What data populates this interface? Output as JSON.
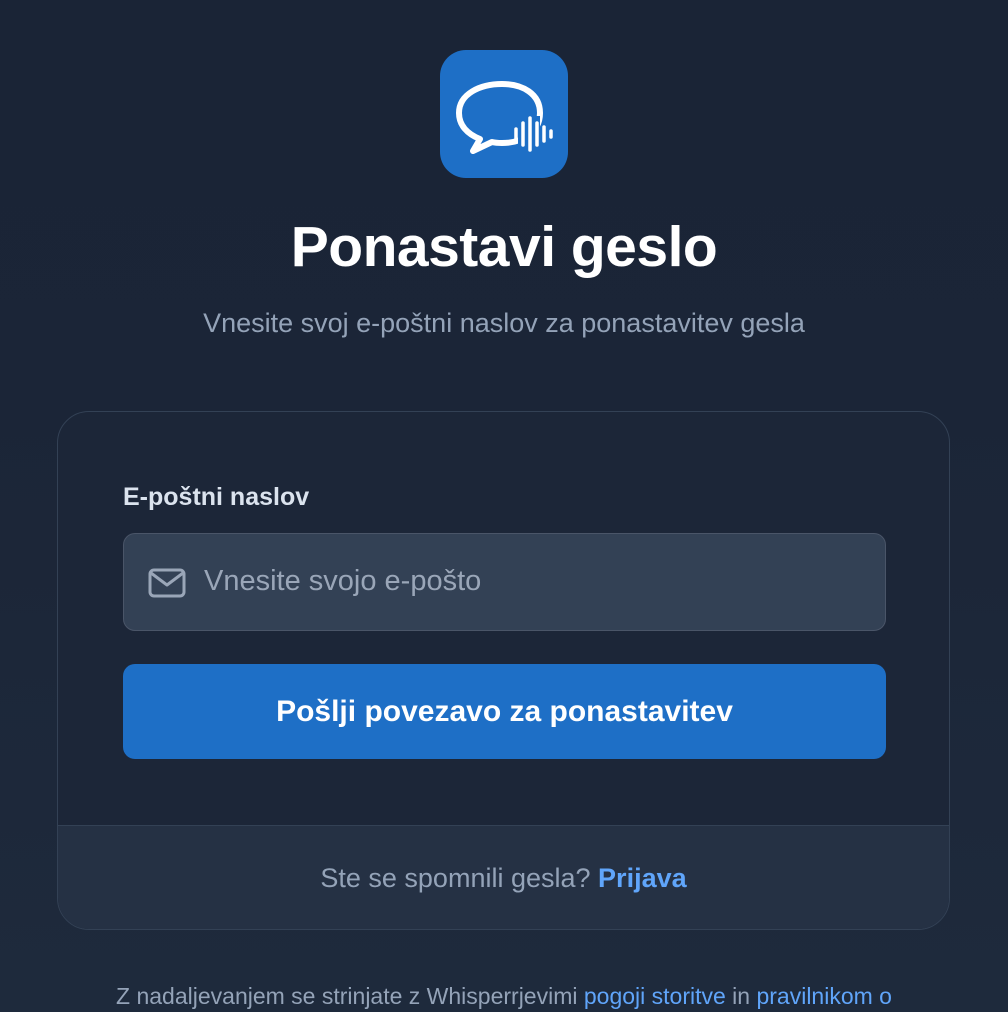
{
  "app": {
    "logo_icon": "chat-bubble-soundwave-icon",
    "brand_color": "#1e6fc6",
    "link_color": "#60a5fa"
  },
  "header": {
    "title": "Ponastavi geslo",
    "subtitle": "Vnesite svoj e-poštni naslov za ponastavitev gesla"
  },
  "form": {
    "email_label": "E-poštni naslov",
    "email_placeholder": "Vnesite svojo e-pošto",
    "email_value": "",
    "email_icon": "mail-icon",
    "submit_label": "Pošlji povezavo za ponastavitev"
  },
  "card_footer": {
    "prompt": "Ste se spomnili gesla?",
    "login_link": "Prijava"
  },
  "legal": {
    "prefix": "Z nadaljevanjem se strinjate z Whisperrjevimi",
    "terms_link": "pogoji storitve",
    "conjunction": "in",
    "privacy_link": "pravilnikom o"
  }
}
